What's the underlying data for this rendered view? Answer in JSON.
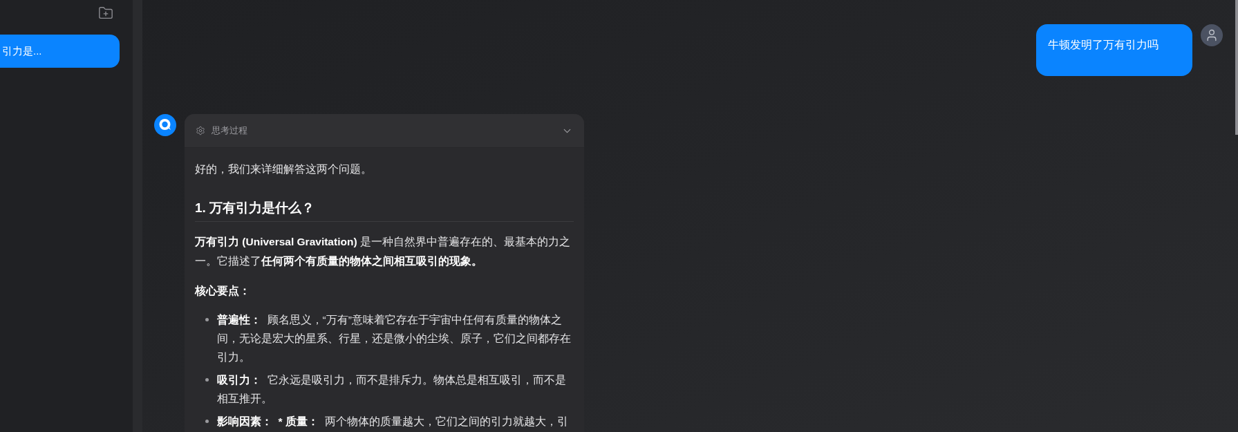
{
  "sidebar": {
    "conversations": [
      {
        "title": "引力是...",
        "selected": true
      }
    ]
  },
  "chat": {
    "messages": [
      {
        "kind": "user",
        "text": "牛顿发明了万有引力吗"
      },
      {
        "kind": "assistant",
        "thinking": {
          "label": "思考过程",
          "expanded": false
        },
        "content": [
          {
            "kind": "paragraph",
            "segments": [
              {
                "text": "好的，我们来详细解答这两个问题。",
                "bold": false
              }
            ]
          },
          {
            "kind": "heading",
            "text": "1. 万有引力是什么？"
          },
          {
            "kind": "paragraph",
            "segments": [
              {
                "text": "万有引力 (Universal Gravitation)",
                "bold": true
              },
              {
                "text": " 是一种自然界中普遍存在的、最基本的力之一。它描述了",
                "bold": false
              },
              {
                "text": "任何两个有质量的物体之间相互吸引的现象。",
                "bold": true
              }
            ]
          },
          {
            "kind": "paragraph",
            "segments": [
              {
                "text": "核心要点：",
                "bold": true
              }
            ]
          },
          {
            "kind": "list",
            "items": [
              {
                "segments": [
                  {
                    "text": "普遍性：",
                    "bold": true
                  },
                  {
                    "text": "  顾名思义，“万有”意味着它存在于宇宙中任何有质量的物体之间，无论是宏大的星系、行星，还是微小的尘埃、原子，它们之间都存在引力。",
                    "bold": false
                  }
                ]
              },
              {
                "segments": [
                  {
                    "text": "吸引力：",
                    "bold": true
                  },
                  {
                    "text": "  它永远是吸引力，而不是排斥力。物体总是相互吸引，而不是相互推开。",
                    "bold": false
                  }
                ]
              },
              {
                "segments": [
                  {
                    "text": "影响因素：  * 质量：",
                    "bold": true
                  },
                  {
                    "text": "  两个物体的质量越大，它们之间的引力就越大，引",
                    "bold": false
                  }
                ]
              }
            ]
          }
        ]
      }
    ]
  }
}
